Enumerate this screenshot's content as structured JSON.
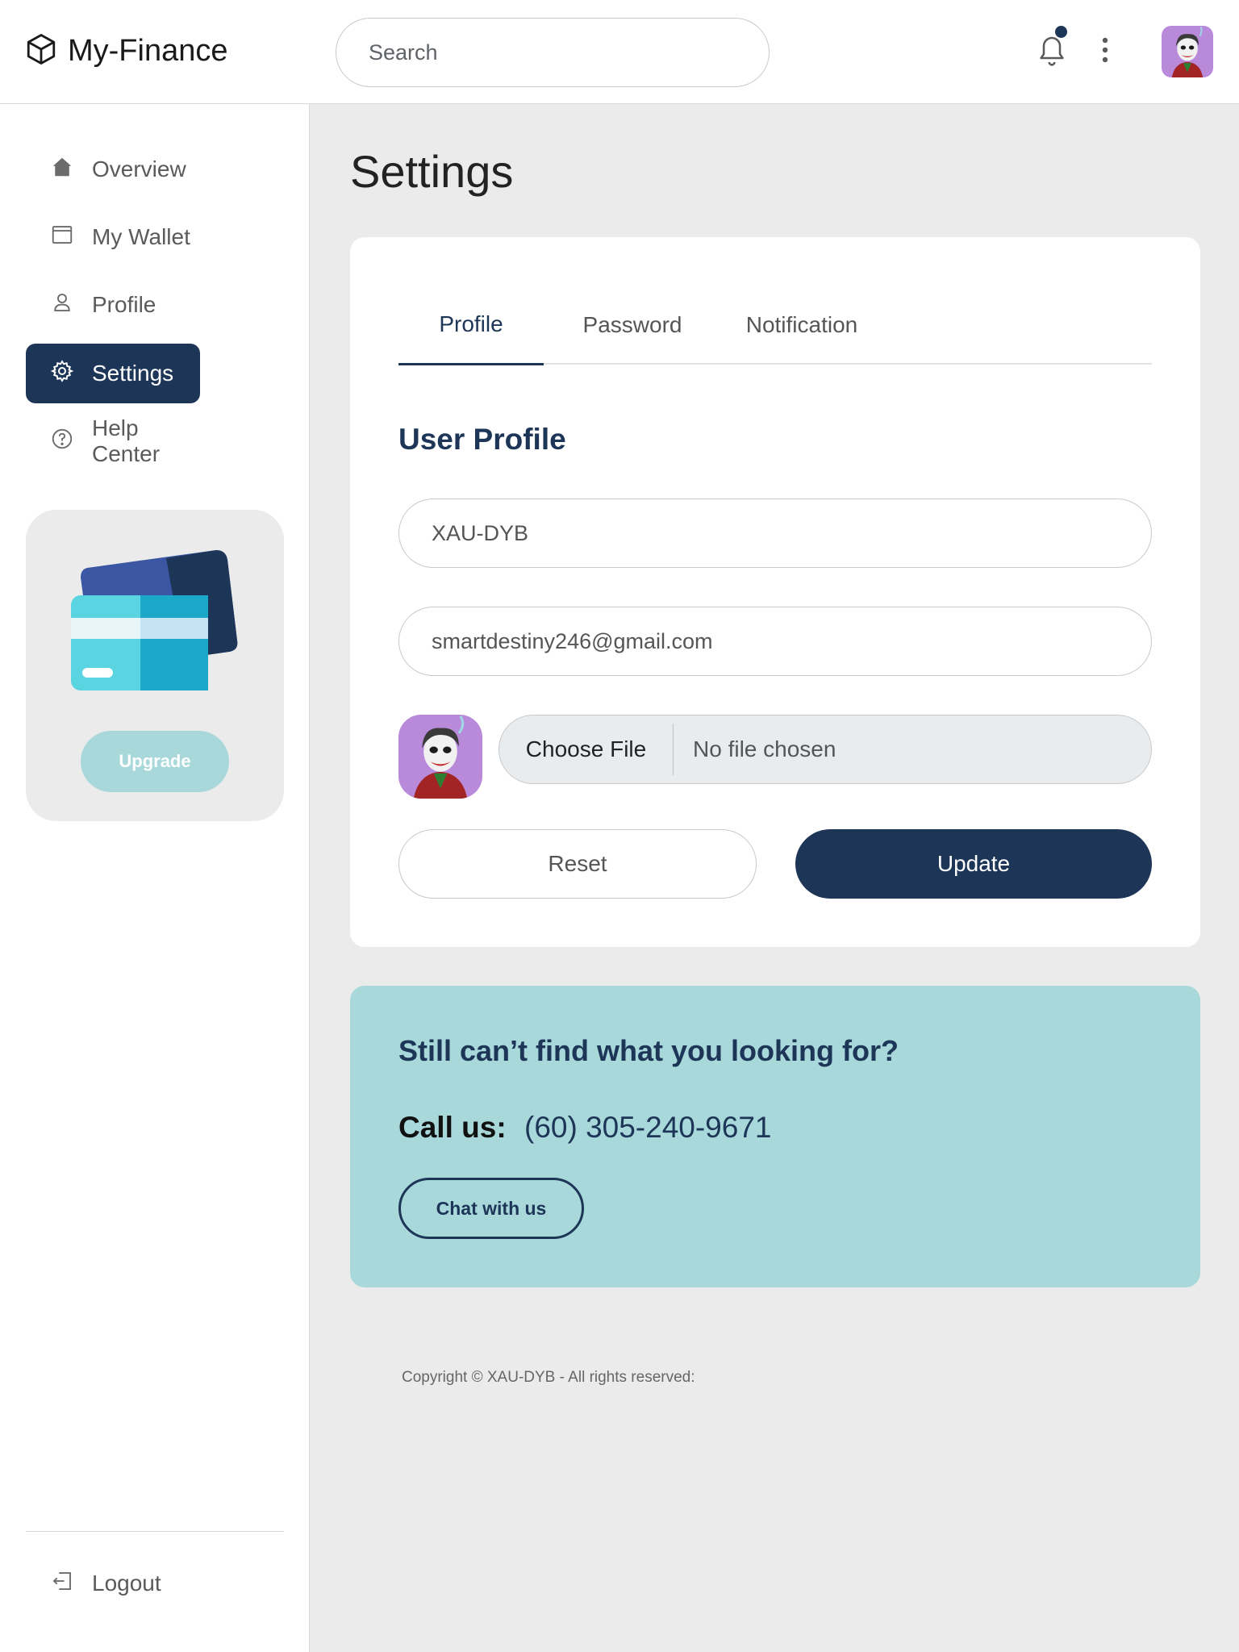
{
  "header": {
    "brand": "My-Finance",
    "search_placeholder": "Search"
  },
  "sidebar": {
    "items": [
      {
        "label": "Overview",
        "icon": "home-icon"
      },
      {
        "label": "My Wallet",
        "icon": "wallet-icon"
      },
      {
        "label": "Profile",
        "icon": "user-icon"
      },
      {
        "label": "Settings",
        "icon": "gear-icon",
        "active": true
      },
      {
        "label": "Help Center",
        "icon": "help-icon"
      }
    ],
    "upgrade_label": "Upgrade",
    "logout_label": "Logout"
  },
  "main": {
    "title": "Settings",
    "tabs": [
      {
        "label": "Profile",
        "active": true
      },
      {
        "label": "Password"
      },
      {
        "label": "Notification"
      }
    ],
    "section_title": "User Profile",
    "username_value": "XAU-DYB",
    "email_value": "smartdestiny246@gmail.com",
    "file_button": "Choose File",
    "file_status": "No file chosen",
    "reset_label": "Reset",
    "update_label": "Update"
  },
  "help": {
    "title": "Still can’t find what you looking for?",
    "call_label": "Call us:",
    "phone": "(60) 305-240-9671",
    "chat_label": "Chat with us"
  },
  "footer": {
    "copyright": "Copyright © XAU-DYB - All rights reserved:"
  },
  "colors": {
    "primary": "#1d3557",
    "accent": "#a8d8da",
    "background": "#ebebeb"
  }
}
